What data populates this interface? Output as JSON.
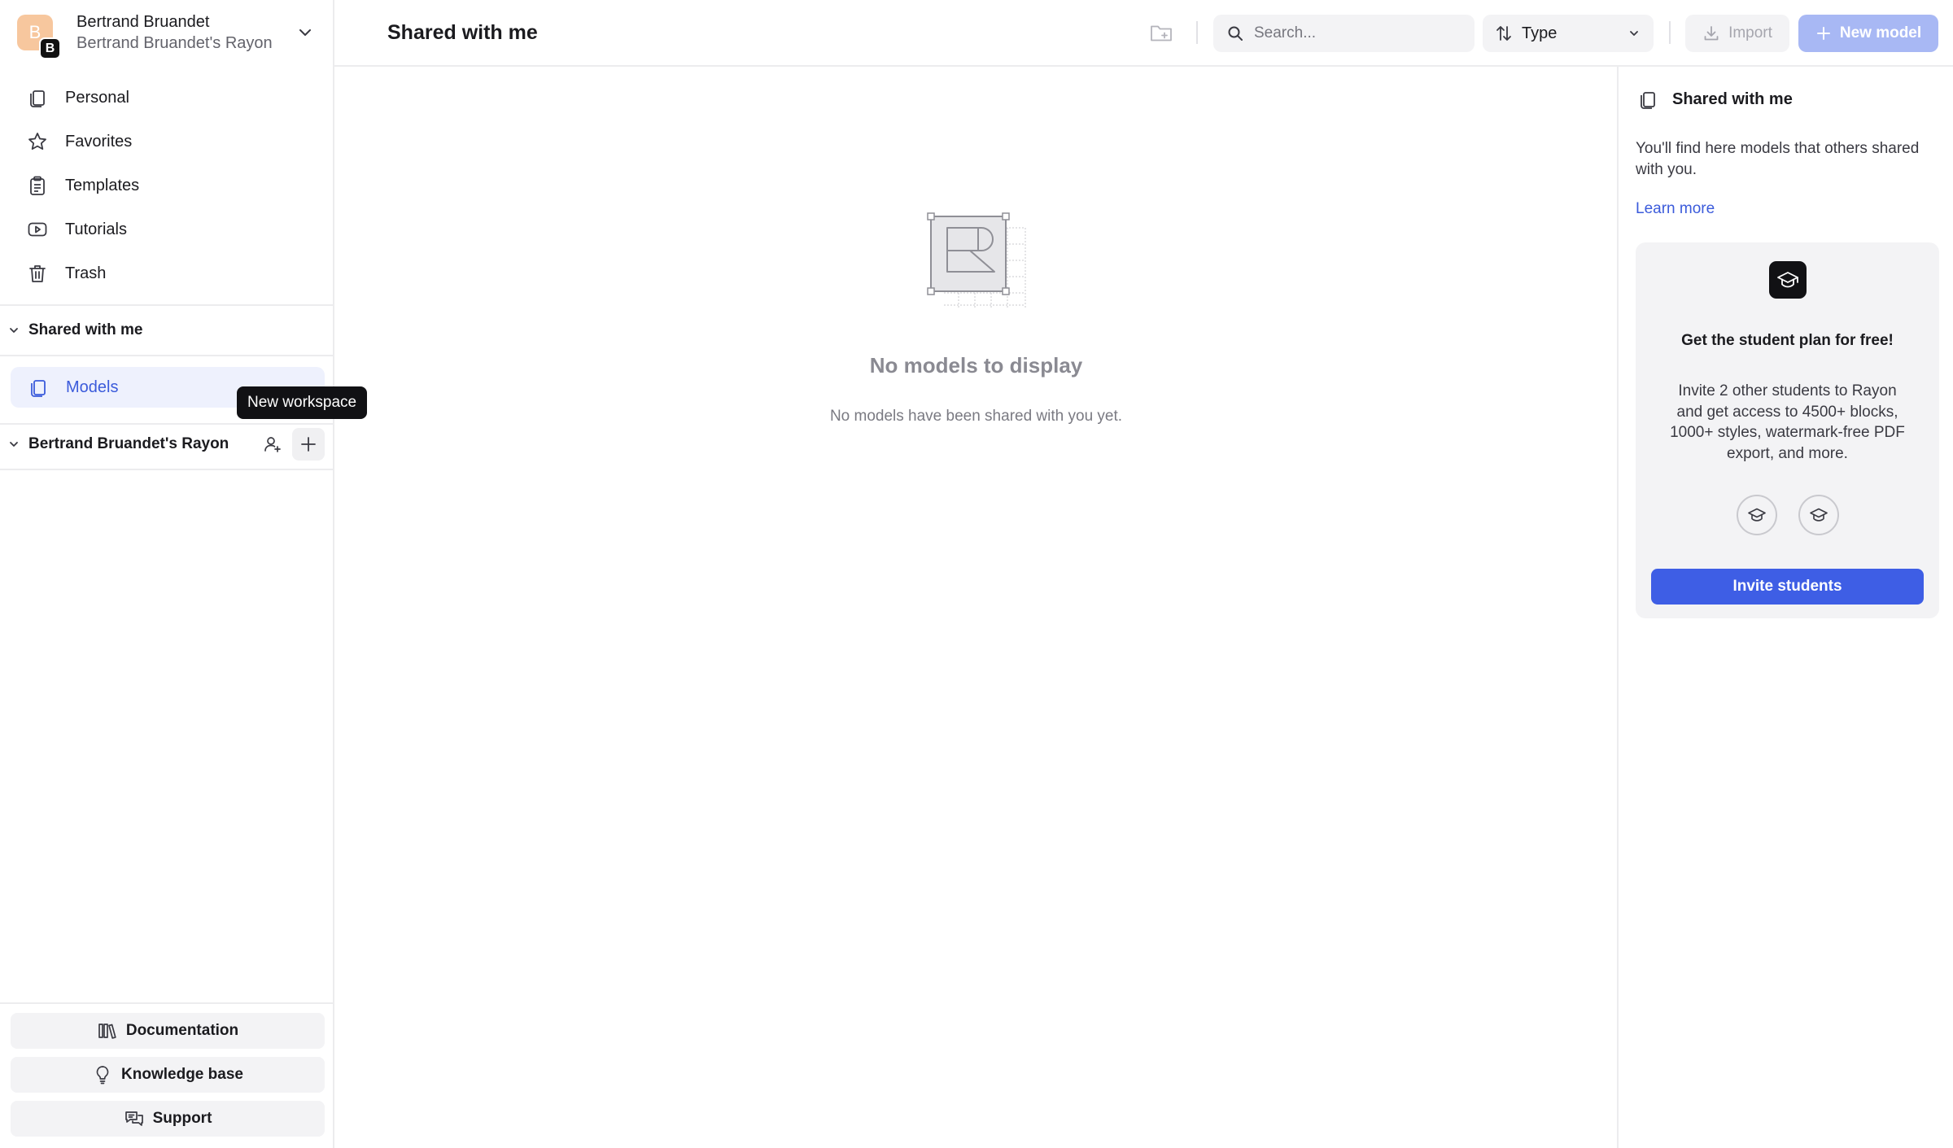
{
  "account": {
    "avatar_initial": "B",
    "badge_initial": "B",
    "name": "Bertrand Bruandet",
    "workspace": "Bertrand Bruandet's Rayon"
  },
  "nav": [
    {
      "label": "Personal",
      "icon": "files-icon"
    },
    {
      "label": "Favorites",
      "icon": "star-icon"
    },
    {
      "label": "Templates",
      "icon": "clipboard-icon"
    },
    {
      "label": "Tutorials",
      "icon": "play-icon"
    },
    {
      "label": "Trash",
      "icon": "trash-icon"
    }
  ],
  "shared_section": {
    "title": "Shared with me",
    "item": "Models"
  },
  "workspace_section": {
    "title": "Bertrand Bruandet's Rayon",
    "tooltip": "New workspace"
  },
  "bottom_links": [
    {
      "label": "Documentation",
      "icon": "library-icon"
    },
    {
      "label": "Knowledge base",
      "icon": "lightbulb-icon"
    },
    {
      "label": "Support",
      "icon": "chat-icon"
    }
  ],
  "topbar": {
    "title": "Shared with me",
    "search_placeholder": "Search...",
    "type_label": "Type",
    "import_label": "Import",
    "new_model_label": "New model"
  },
  "empty_state": {
    "title": "No models to display",
    "subtitle": "No models have been shared with you yet."
  },
  "right_panel": {
    "title": "Shared with me",
    "description": "You'll find here models that others shared with you.",
    "learn_more": "Learn more",
    "promo": {
      "title": "Get the student plan for free!",
      "text": "Invite 2 other students to Rayon and get access to 4500+ blocks, 1000+ styles, watermark-free PDF export, and more.",
      "slots": 2,
      "button": "Invite students"
    }
  },
  "colors": {
    "accent": "#3e5ee5",
    "accent_disabled": "#a8b8f4",
    "selected_bg": "#eef1fd",
    "avatar": "#f7c79e"
  }
}
